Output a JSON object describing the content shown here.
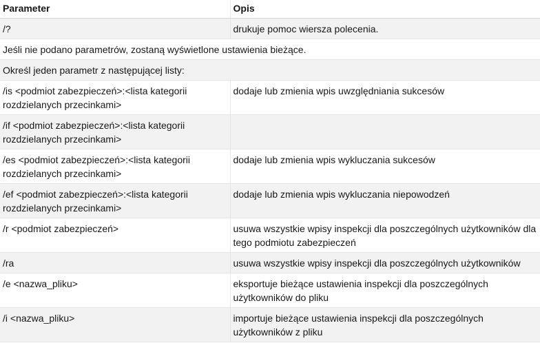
{
  "table": {
    "headers": [
      "Parameter",
      "Opis"
    ],
    "rows": [
      {
        "param": "/?",
        "desc": "drukuje pomoc wiersza polecenia."
      },
      {
        "span": "Jeśli nie podano parametrów, zostaną wyświetlone ustawienia bieżące."
      },
      {
        "span": "Określ jeden parametr z następującej listy:"
      },
      {
        "param": "/is <podmiot zabezpieczeń>:<lista kategorii rozdzielanych przecinkami>",
        "desc": "dodaje lub zmienia wpis uwzględniania sukcesów"
      },
      {
        "param": "/if <podmiot zabezpieczeń>:<lista kategorii rozdzielanych przecinkami>",
        "desc": ""
      },
      {
        "param": "/es <podmiot zabezpieczeń>:<lista kategorii rozdzielanych przecinkami>",
        "desc": "dodaje lub zmienia wpis wykluczania sukcesów"
      },
      {
        "param": "/ef <podmiot zabezpieczeń>:<lista kategorii rozdzielanych przecinkami>",
        "desc": "dodaje lub zmienia wpis wykluczania niepowodzeń"
      },
      {
        "param": "/r <podmiot zabezpieczeń>",
        "desc": "usuwa wszystkie wpisy inspekcji dla poszczególnych użytkowników dla tego podmiotu zabezpieczeń"
      },
      {
        "param": "/ra",
        "desc": "usuwa wszystkie wpisy inspekcji dla poszczególnych użytkowników"
      },
      {
        "param": "/e <nazwa_pliku>",
        "desc": "eksportuje bieżące ustawienia inspekcji dla poszczególnych użytkowników do pliku"
      },
      {
        "param": "/i <nazwa_pliku>",
        "desc": "importuje bieżące ustawienia inspekcji dla poszczególnych użytkowników z pliku"
      }
    ]
  }
}
